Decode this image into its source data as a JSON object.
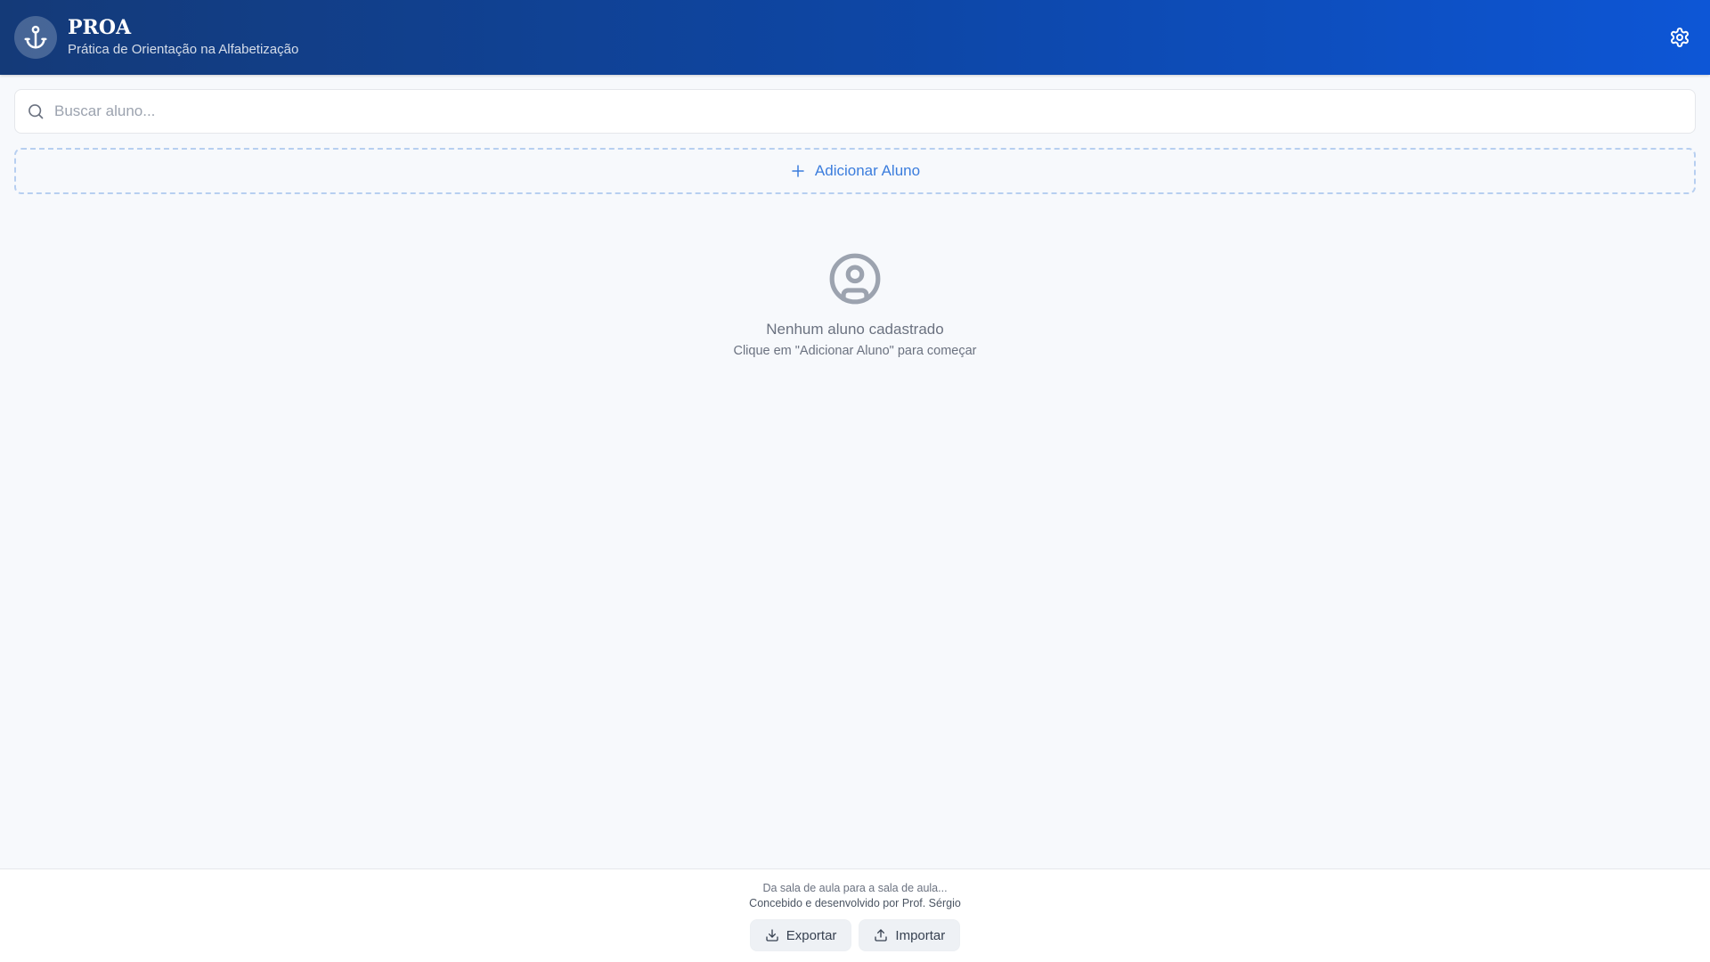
{
  "header": {
    "title": "PROA",
    "subtitle": "Prática de Orientação na Alfabetização",
    "logo_icon": "anchor-icon",
    "settings_icon": "gear-icon"
  },
  "search": {
    "placeholder": "Buscar aluno...",
    "value": "",
    "icon": "search-icon"
  },
  "add_student": {
    "label": "Adicionar Aluno",
    "icon": "plus-icon"
  },
  "empty_state": {
    "icon": "user-circle-icon",
    "title": "Nenhum aluno cadastrado",
    "subtitle": "Clique em \"Adicionar Aluno\" para começar"
  },
  "footer": {
    "tagline": "Da sala de aula para a sala de aula...",
    "credit": "Concebido e desenvolvido por Prof. Sérgio",
    "export_label": "Exportar",
    "import_label": "Importar",
    "export_icon": "download-icon",
    "import_icon": "upload-icon"
  },
  "colors": {
    "header_gradient_start": "#143a78",
    "header_gradient_end": "#0d56d6",
    "accent": "#3b7ddd",
    "page_background": "#f7f9fc",
    "dashed_border": "#b7cff0"
  }
}
